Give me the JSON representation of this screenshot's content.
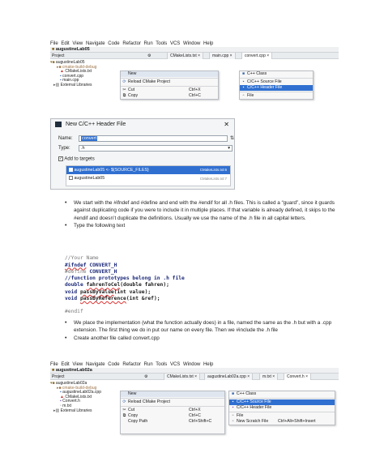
{
  "ide1": {
    "menubar": [
      "File",
      "Edit",
      "View",
      "Navigate",
      "Code",
      "Refactor",
      "Run",
      "Tools",
      "VCS",
      "Window",
      "Help"
    ],
    "nav": "augustineLab05",
    "project_label": "Project",
    "tabs": [
      "CMakeLists.txt",
      "main.cpp",
      "convert.cpp"
    ],
    "tree": [
      "augustineLab05",
      "cmake-build-debug",
      "CMakeLists.txt",
      "convert.cpp",
      "main.cpp",
      "External Libraries"
    ],
    "menu_left": [
      {
        "label": "New",
        "shortcut": ""
      },
      {
        "label": "Reload CMake Project",
        "shortcut": ""
      },
      {
        "label": "Cut",
        "shortcut": "Ctrl+X"
      },
      {
        "label": "Copy",
        "shortcut": "Ctrl+C"
      }
    ],
    "menu_right": [
      "C++ Class",
      "C/C++ Source File",
      "C/C++ Header File",
      "File"
    ]
  },
  "dialog": {
    "title": "New C/C++ Header File",
    "name_label": "Name:",
    "name_value": "convert",
    "type_label": "Type:",
    "type_value": ".h",
    "add_targets": "Add to targets",
    "targets": [
      {
        "name": "augustineLab05 <- ${SOURCE_FILES}",
        "file": "CMakeLists.txt:6"
      },
      {
        "name": "augustineLab05",
        "file": "CMakeLists.txt:7"
      }
    ]
  },
  "para1": [
    "We start with the #ifndef and #define and end with the #endif for all .h files. This is called a “guard”, since it guards against duplicating code if you were to include it in multiple places. If that variable is already defined, it skips to the #endif and doesn’t duplicate the definitions. Usually we use the name of the .h file in all capital letters.",
    "Type the following text"
  ],
  "code": {
    "c1": "//Your Name",
    "l1_kw": "#ifndef",
    "l1_rest": " CONVERT_H",
    "l2_kw": "#define",
    "l2_rest": " CONVERT_H",
    "c2": "//function prototypes belong in .h file",
    "l3_type": "double",
    "l3_fn": "fahrenToCel",
    "l3_args": "(double fahren);",
    "l4_type": "void",
    "l4_fn": "passByValue",
    "l4_args": "(int value);",
    "l5_type": "void",
    "l5_fn": "passByReference",
    "l5_args": "(int &ref);",
    "endif": "#endif"
  },
  "para2": [
    "We place the implementation (what the function actually does) in a file, named the same as the .h but with a .cpp extension. The first thing we do in put our name on every file. Then we #include the .h file",
    "Create another file called convert.cpp"
  ],
  "ide2": {
    "menubar": [
      "File",
      "Edit",
      "View",
      "Navigate",
      "Code",
      "Refactor",
      "Run",
      "Tools",
      "VCS",
      "Window",
      "Help"
    ],
    "nav": "augustineLab02a",
    "project_label": "Project",
    "tabs": [
      "CMakeLists.txt",
      "augustineLab02a.cpp",
      "m.txt",
      "Convert.h"
    ],
    "tree": [
      "augustineLab02a",
      "cmake-build-debug",
      "augustineLab02a.cpp",
      "CMakeLists.txt",
      "Convert.h",
      "m.txt",
      "External Libraries"
    ],
    "menu_left": [
      {
        "label": "New",
        "shortcut": ""
      },
      {
        "label": "Reload CMake Project",
        "shortcut": ""
      },
      {
        "label": "Cut",
        "shortcut": "Ctrl+X"
      },
      {
        "label": "Copy",
        "shortcut": "Ctrl+C"
      },
      {
        "label": "Copy Path",
        "shortcut": "Ctrl+Shift+C"
      }
    ],
    "menu_right": [
      {
        "label": "C++ Class",
        "shortcut": ""
      },
      {
        "label": "C/C++ Source File",
        "shortcut": ""
      },
      {
        "label": "C/C++ Header File",
        "shortcut": ""
      },
      {
        "label": "File",
        "shortcut": ""
      },
      {
        "label": "New Scratch File",
        "shortcut": "Ctrl+Alt+Shift+Insert"
      }
    ]
  },
  "colors": {
    "highlight": "#2f6fd0",
    "keyword": "#1d2a7a"
  }
}
